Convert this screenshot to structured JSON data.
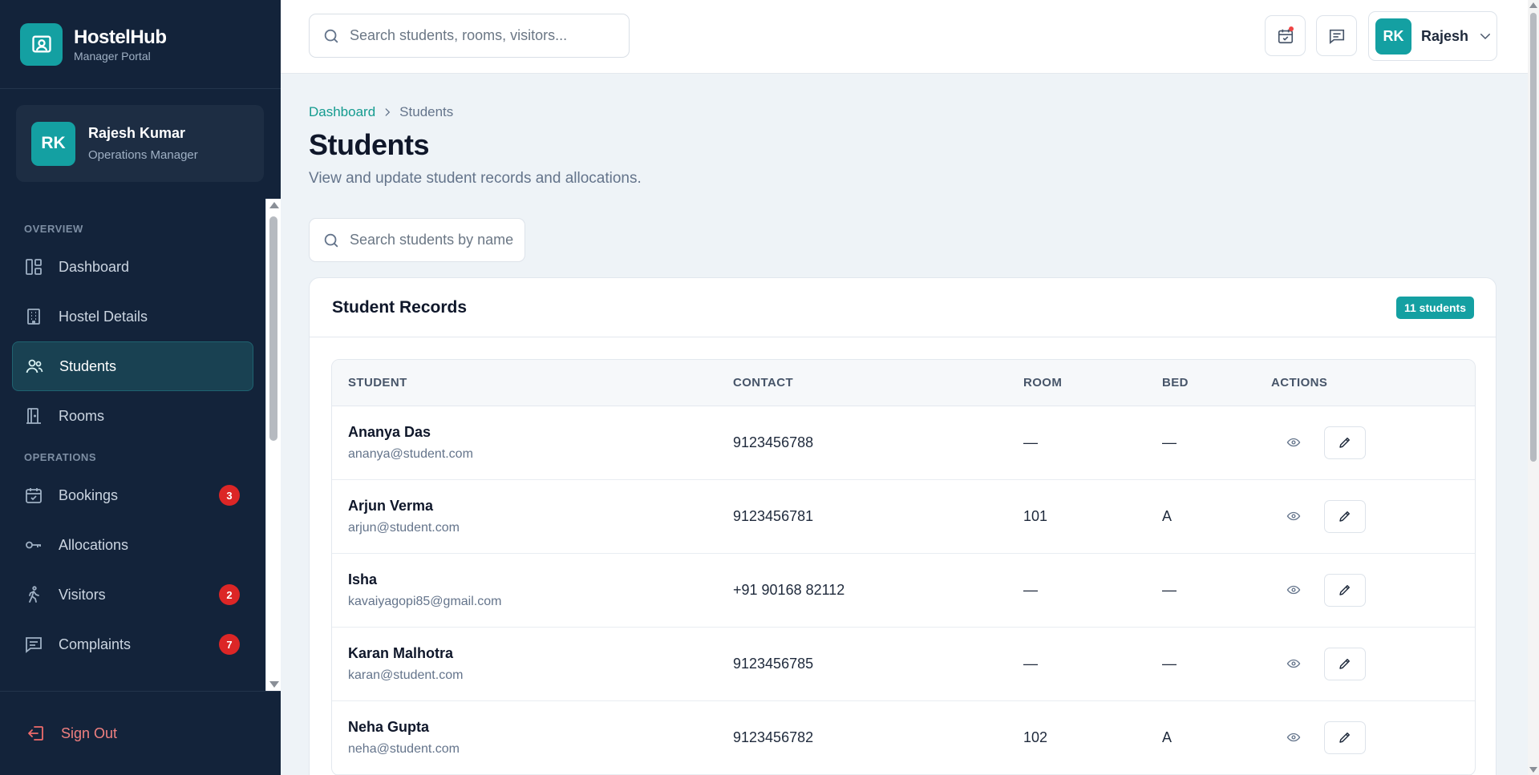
{
  "brand": {
    "name": "HostelHub",
    "subtitle": "Manager Portal",
    "logo_icon": "id-badge-icon"
  },
  "profile": {
    "initials": "RK",
    "name": "Rajesh Kumar",
    "role": "Operations Manager"
  },
  "nav": {
    "sections": [
      {
        "title": "OVERVIEW",
        "items": [
          {
            "label": "Dashboard",
            "icon": "dashboard-icon",
            "active": false
          },
          {
            "label": "Hostel Details",
            "icon": "building-icon",
            "active": false
          },
          {
            "label": "Students",
            "icon": "users-icon",
            "active": true
          },
          {
            "label": "Rooms",
            "icon": "door-icon",
            "active": false
          }
        ]
      },
      {
        "title": "OPERATIONS",
        "items": [
          {
            "label": "Bookings",
            "icon": "calendar-check-icon",
            "badge": "3"
          },
          {
            "label": "Allocations",
            "icon": "key-icon"
          },
          {
            "label": "Visitors",
            "icon": "walking-person-icon",
            "badge": "2"
          },
          {
            "label": "Complaints",
            "icon": "message-icon",
            "badge": "7"
          }
        ]
      }
    ],
    "sign_out": "Sign Out"
  },
  "header": {
    "search_placeholder": "Search students, rooms, visitors...",
    "user_initials": "RK",
    "user_name": "Rajesh"
  },
  "breadcrumb": {
    "root": "Dashboard",
    "current": "Students"
  },
  "page": {
    "title": "Students",
    "subtitle": "View and update student records and allocations.",
    "search_placeholder": "Search students by name..."
  },
  "records": {
    "title": "Student Records",
    "count_label": "11 students",
    "columns": [
      "STUDENT",
      "CONTACT",
      "ROOM",
      "BED",
      "ACTIONS"
    ],
    "rows": [
      {
        "name": "Ananya Das",
        "email": "ananya@student.com",
        "contact": "9123456788",
        "room": "—",
        "bed": "—"
      },
      {
        "name": "Arjun Verma",
        "email": "arjun@student.com",
        "contact": "9123456781",
        "room": "101",
        "bed": "A"
      },
      {
        "name": "Isha",
        "email": "kavaiyagopi85@gmail.com",
        "contact": "+91 90168 82112",
        "room": "—",
        "bed": "—"
      },
      {
        "name": "Karan Malhotra",
        "email": "karan@student.com",
        "contact": "9123456785",
        "room": "—",
        "bed": "—"
      },
      {
        "name": "Neha Gupta",
        "email": "neha@student.com",
        "contact": "9123456782",
        "room": "102",
        "bed": "A"
      }
    ]
  },
  "colors": {
    "accent": "#14a0a2",
    "sidebar_bg": "#13233a",
    "badge_red": "#dc2626",
    "link": "#149b8f"
  }
}
